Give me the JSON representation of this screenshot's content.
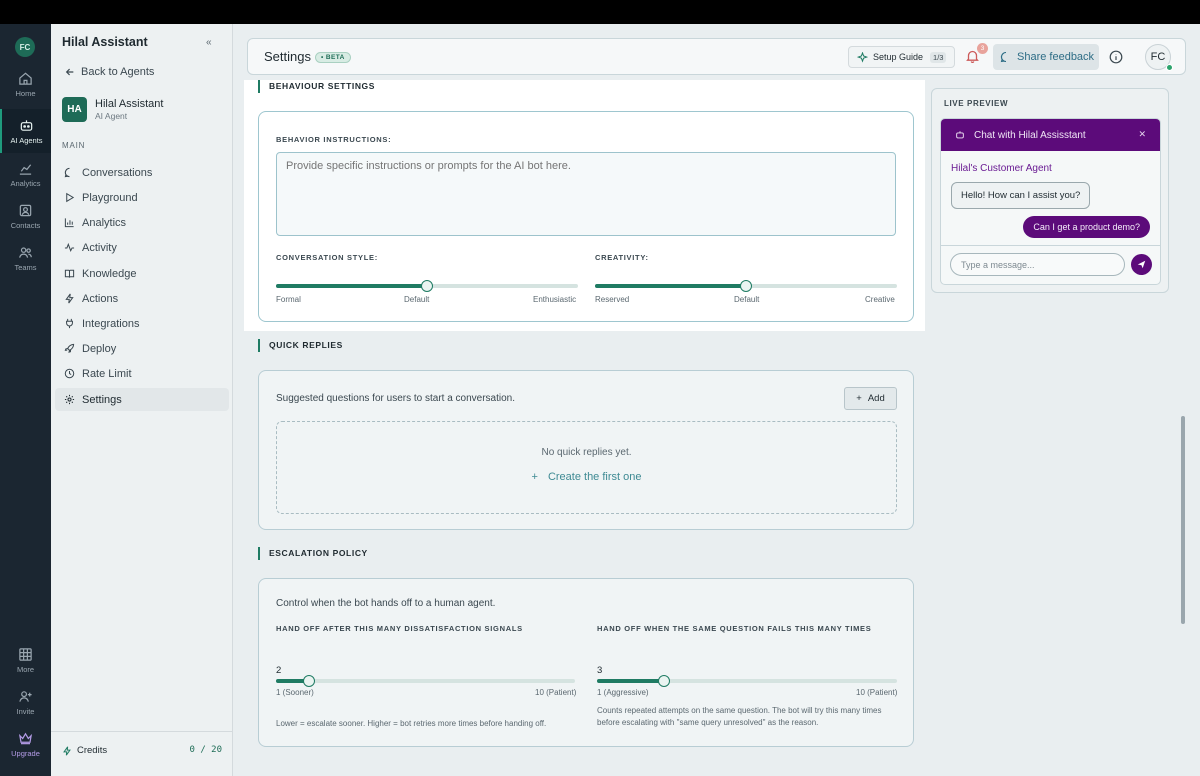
{
  "rail": {
    "user_initials": "FC",
    "items": [
      {
        "label": "Home",
        "icon": "home-icon"
      },
      {
        "label": "AI Agents",
        "icon": "robot-icon"
      },
      {
        "label": "Analytics",
        "icon": "analytics-icon"
      },
      {
        "label": "Contacts",
        "icon": "contacts-icon"
      },
      {
        "label": "Teams",
        "icon": "teams-icon"
      }
    ],
    "bottom": [
      {
        "label": "More",
        "icon": "grid-icon"
      },
      {
        "label": "Invite",
        "icon": "invite-icon"
      },
      {
        "label": "Upgrade",
        "icon": "crown-icon"
      }
    ]
  },
  "sidebar": {
    "title": "Hilal Assistant",
    "back_label": "Back to Agents",
    "agent": {
      "initials": "HA",
      "name": "Hilal Assistant",
      "type": "AI Agent"
    },
    "section": "MAIN",
    "items": [
      {
        "label": "Conversations",
        "icon": "chat-icon"
      },
      {
        "label": "Playground",
        "icon": "play-icon"
      },
      {
        "label": "Analytics",
        "icon": "bar-chart-icon"
      },
      {
        "label": "Activity",
        "icon": "activity-icon"
      },
      {
        "label": "Knowledge",
        "icon": "book-icon"
      },
      {
        "label": "Actions",
        "icon": "bolt-icon"
      },
      {
        "label": "Integrations",
        "icon": "plug-icon"
      },
      {
        "label": "Deploy",
        "icon": "rocket-icon"
      },
      {
        "label": "Rate Limit",
        "icon": "clock-icon"
      },
      {
        "label": "Settings",
        "icon": "gear-icon"
      }
    ],
    "active_item": "Settings",
    "credits_label": "Credits",
    "credits_value": "0 / 20"
  },
  "header": {
    "title": "Settings",
    "beta": "• BETA",
    "setup_label": "Setup Guide",
    "setup_count": "1/3",
    "notifications": "3",
    "feedback_label": "Share feedback",
    "user_initials": "FC"
  },
  "behaviour": {
    "section": "BEHAVIOUR SETTINGS",
    "instructions_label": "BEHAVIOR INSTRUCTIONS:",
    "instructions_placeholder": "Provide specific instructions or prompts for the AI bot here.",
    "style": {
      "label": "CONVERSATION STYLE:",
      "min": "Formal",
      "mid": "Default",
      "max": "Enthusiastic",
      "value": 0.5
    },
    "creativity": {
      "label": "CREATIVITY:",
      "min": "Reserved",
      "mid": "Default",
      "max": "Creative",
      "value": 0.5
    }
  },
  "quick_replies": {
    "section": "QUICK REPLIES",
    "description": "Suggested questions for users to start a conversation.",
    "add_label": "Add",
    "empty_text": "No quick replies yet.",
    "create_label": "Create the first one"
  },
  "escalation": {
    "section": "ESCALATION POLICY",
    "description": "Control when the bot hands off to a human agent.",
    "signals": {
      "label": "HAND OFF AFTER THIS MANY DISSATISFACTION SIGNALS",
      "value": "2",
      "value_num": 2,
      "min": 1,
      "max": 10,
      "min_label": "1 (Sooner)",
      "max_label": "10 (Patient)",
      "note": "Lower = escalate sooner. Higher = bot retries more times before handing off."
    },
    "failures": {
      "label": "HAND OFF WHEN THE SAME QUESTION FAILS THIS MANY TIMES",
      "value": "3",
      "value_num": 3,
      "min": 1,
      "max": 10,
      "min_label": "1 (Aggressive)",
      "max_label": "10 (Patient)",
      "note": "Counts repeated attempts on the same question. The bot will try this many times before escalating with \"same query unresolved\" as the reason."
    }
  },
  "preview": {
    "label": "LIVE PREVIEW",
    "chat_title": "Chat with Hilal Assisstant",
    "agent_name": "Hilal's Customer Agent",
    "bot_message": "Hello! How can I assist you?",
    "user_message": "Can I get a product demo?",
    "input_placeholder": "Type a message...",
    "accent": "#5c0b7a"
  },
  "colors": {
    "brand": "#1f7b63",
    "chat_accent": "#5c0b7a",
    "notification": "#cc5b5b"
  }
}
